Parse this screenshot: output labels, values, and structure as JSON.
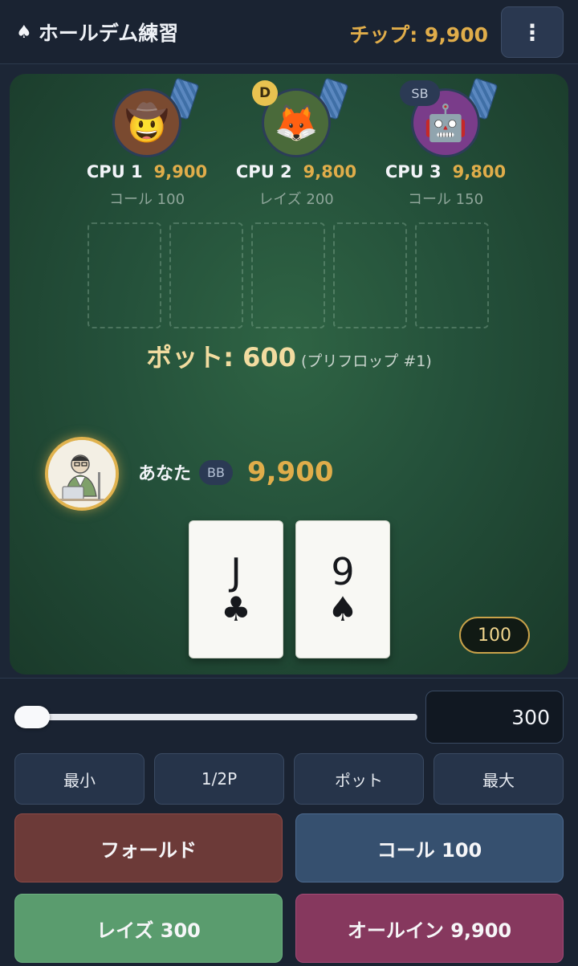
{
  "header": {
    "title": "ホールデム練習",
    "chips": "チップ: 9,900",
    "menu_icon": "⋮"
  },
  "opponents": [
    {
      "name": "CPU 1",
      "stack": "9,900",
      "action": "コール 100",
      "avatar": "🤠",
      "avatar_bg": "#7a4a30",
      "badge": ""
    },
    {
      "name": "CPU 2",
      "stack": "9,800",
      "action": "レイズ 200",
      "avatar": "🦊",
      "avatar_bg": "#4a6a3a",
      "badge": "D"
    },
    {
      "name": "CPU 3",
      "stack": "9,800",
      "action": "コール 150",
      "avatar": "🤖",
      "avatar_bg": "#7a3c8a",
      "badge": "SB"
    }
  ],
  "board": {
    "slots": 5
  },
  "pot": {
    "label": "ポット: 600",
    "street": "(プリフロップ #1)"
  },
  "hero": {
    "name": "あなた",
    "badge": "BB",
    "stack": "9,900",
    "cards": [
      {
        "rank": "J",
        "suit": "♣"
      },
      {
        "rank": "9",
        "suit": "♠"
      }
    ],
    "current_bet": "100"
  },
  "controls": {
    "bet_amount": "300",
    "slider_fraction": 0.0,
    "presets": [
      "最小",
      "1/2P",
      "ポット",
      "最大"
    ],
    "fold": "フォールド",
    "call": "コール 100",
    "raise": "レイズ 300",
    "allin": "オールイン 9,900"
  },
  "colors": {
    "accent_gold": "#e0ad4a",
    "felt": "#24503a",
    "fold": "#6c3a38",
    "call": "#36506f",
    "raise": "#5a9c6e",
    "allin": "#86385e"
  }
}
